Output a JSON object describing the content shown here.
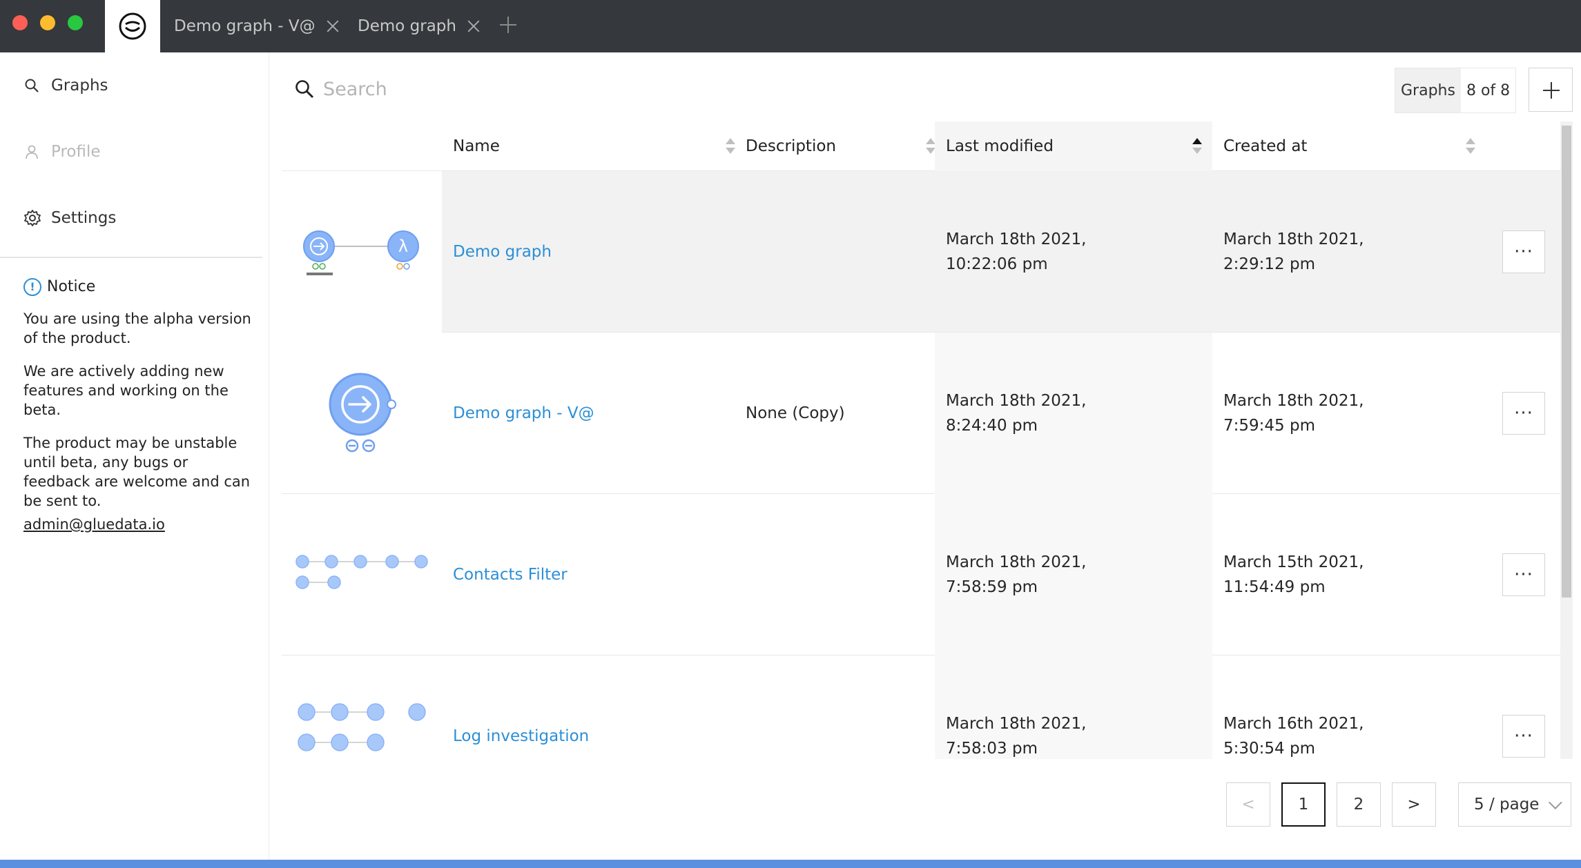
{
  "window": {
    "tabs": [
      {
        "label": "Demo graph - V@"
      },
      {
        "label": "Demo graph"
      }
    ]
  },
  "sidebar": {
    "items": [
      {
        "label": "Graphs",
        "icon": "search-icon"
      },
      {
        "label": "Profile",
        "icon": "user-icon"
      },
      {
        "label": "Settings",
        "icon": "gear-icon"
      }
    ],
    "notice": {
      "title": "Notice",
      "paragraphs": [
        "You are using the alpha version of the product.",
        "We are actively adding new features and working on the beta.",
        "The product may be unstable until beta, any bugs or feedback are welcome and can be sent to."
      ],
      "email": "admin@gluedata.io"
    }
  },
  "main": {
    "search": {
      "placeholder": "Search",
      "value": ""
    },
    "count": {
      "label": "Graphs",
      "value": "8 of 8"
    },
    "table": {
      "columns": [
        {
          "label": "Name"
        },
        {
          "label": "Description"
        },
        {
          "label": "Last modified",
          "sorted": "asc"
        },
        {
          "label": "Created at"
        }
      ],
      "rows": [
        {
          "name": "Demo graph",
          "description": "",
          "last_modified_1": "March 18th 2021,",
          "last_modified_2": "10:22:06 pm",
          "created_1": "March 18th 2021,",
          "created_2": "2:29:12 pm",
          "more": "···"
        },
        {
          "name": "Demo graph - V@",
          "description": "None (Copy)",
          "last_modified_1": "March 18th 2021,",
          "last_modified_2": "8:24:40 pm",
          "created_1": "March 18th 2021,",
          "created_2": "7:59:45 pm",
          "more": "···"
        },
        {
          "name": "Contacts Filter",
          "description": "",
          "last_modified_1": "March 18th 2021,",
          "last_modified_2": "7:58:59 pm",
          "created_1": "March 15th 2021,",
          "created_2": "11:54:49 pm",
          "more": "···"
        },
        {
          "name": "Log investigation",
          "description": "",
          "last_modified_1": "March 18th 2021,",
          "last_modified_2": "7:58:03 pm",
          "created_1": "March 16th 2021,",
          "created_2": "5:30:54 pm",
          "more": "···"
        }
      ]
    },
    "pagination": {
      "prev": "<",
      "pages": [
        "1",
        "2"
      ],
      "current": "1",
      "next": ">",
      "page_size": "5 / page"
    }
  },
  "colors": {
    "titlebar": "#35383c",
    "link": "#2b8fd6",
    "node": "#8ab4f8",
    "bottom_bar": "#5b8fe0"
  }
}
